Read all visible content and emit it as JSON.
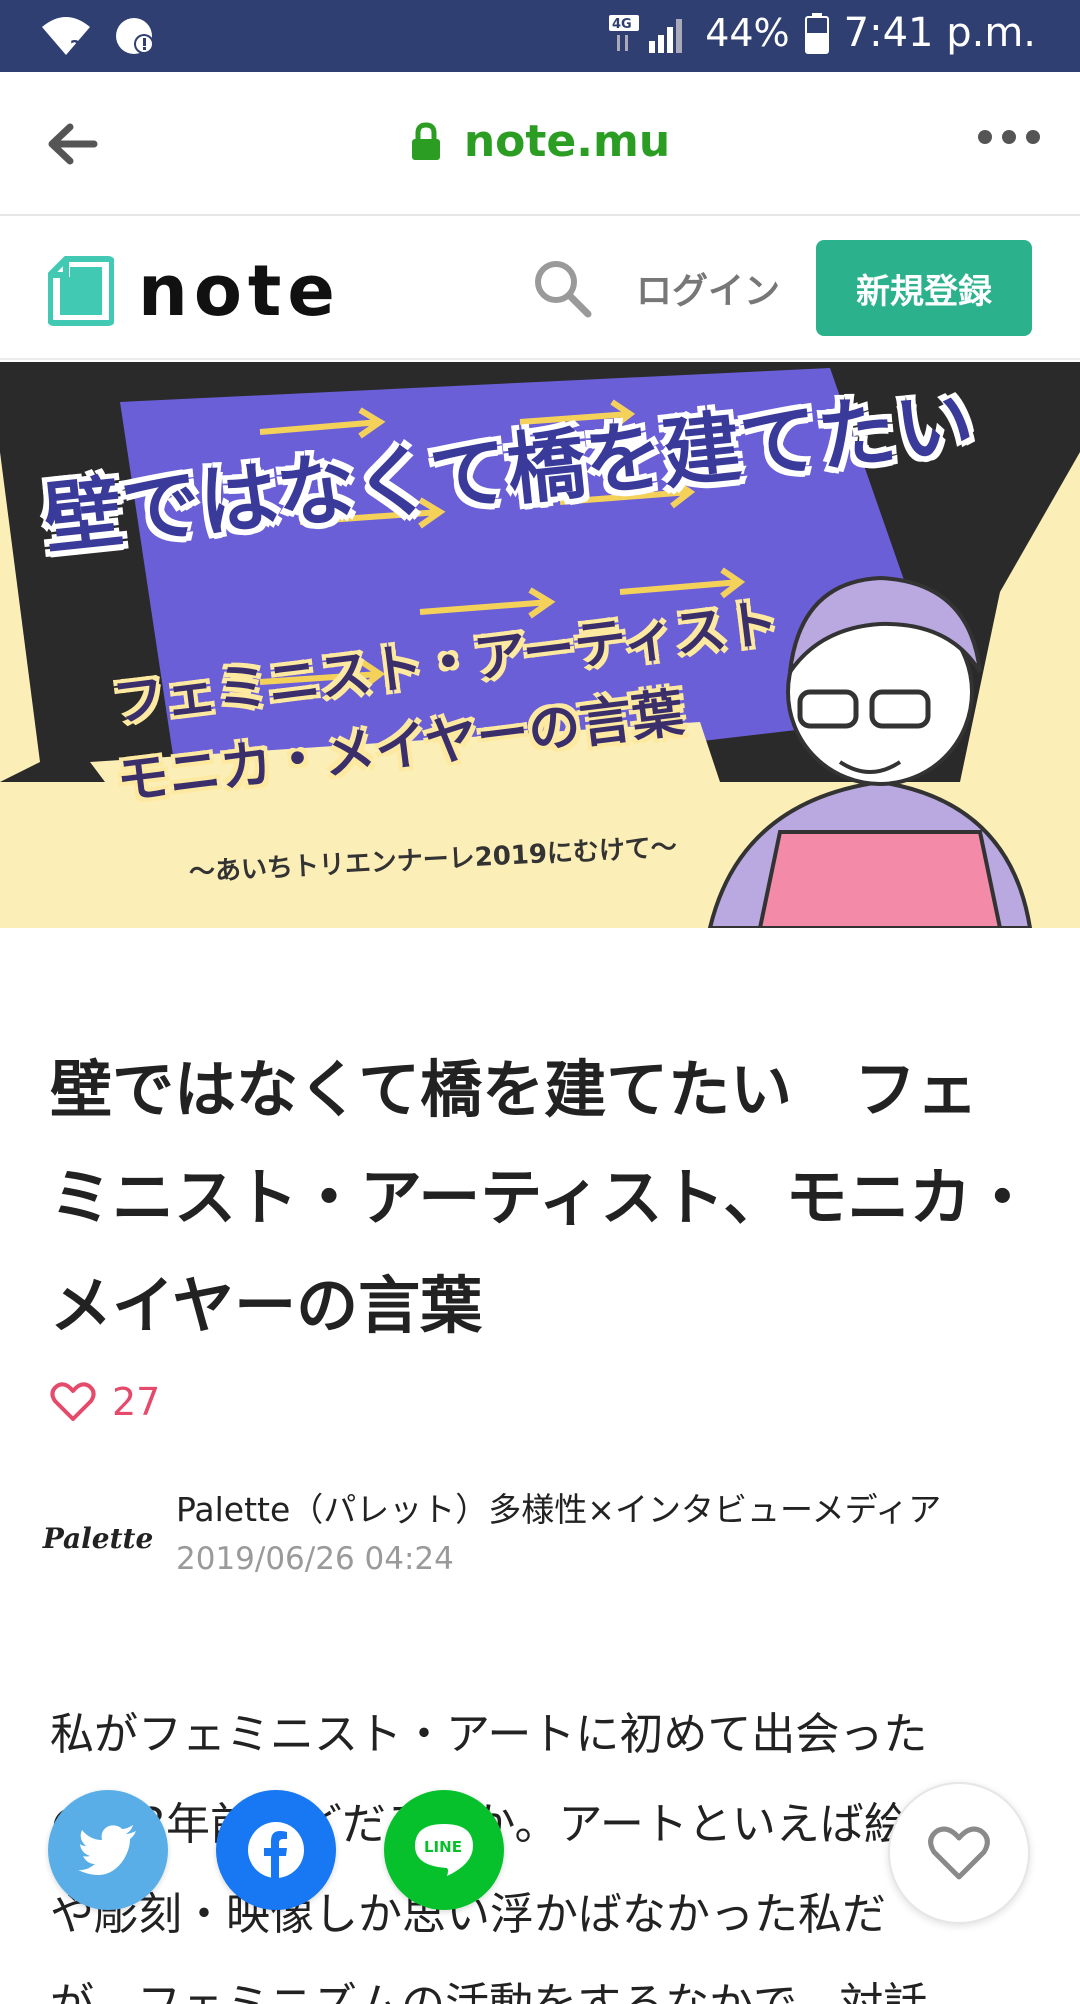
{
  "status_bar": {
    "network_type": "4G",
    "battery_percent": "44%",
    "time": "7:41 p.m."
  },
  "browser": {
    "url": "note.mu"
  },
  "header": {
    "logo_text": "note",
    "login_label": "ログイン",
    "signup_label": "新規登録"
  },
  "banner": {
    "title": "壁ではなくて橋を建てたい",
    "subtitle_line1": "フェミニスト・アーティスト",
    "subtitle_line2": "モニカ・メイヤーの言葉",
    "caption": "〜あいちトリエンナーレ2019にむけて〜"
  },
  "article": {
    "title": "壁ではなくて橋を建てたい　フェミニスト・アーティスト、モニカ・メイヤーの言葉",
    "likes": "27",
    "author_name": "Palette（パレット）多様性×インタビューメディア",
    "author_avatar_text": "Palette",
    "date": "2019/06/26 04:24",
    "body": "私がフェミニスト・アートに初めて出会った\nのは3年前ほどだろうか。アートといえば絵画\nや彫刻・映像しか思い浮かばなかった私だ\nが、フェミニズムの活動をするなかで、対話"
  },
  "colors": {
    "status_bar": "#2f3f72",
    "url_green": "#2a9d22",
    "signup_green": "#2bb28c",
    "like_pink": "#e54a6b",
    "twitter": "#5aaee8",
    "facebook": "#1877f2",
    "line": "#06c12b"
  },
  "icons": [
    "wifi-icon",
    "alert-icon",
    "signal-icon",
    "battery-icon",
    "back-arrow-icon",
    "lock-icon",
    "more-icon",
    "note-logo-icon",
    "search-icon",
    "heart-icon",
    "twitter-icon",
    "facebook-icon",
    "line-icon"
  ]
}
